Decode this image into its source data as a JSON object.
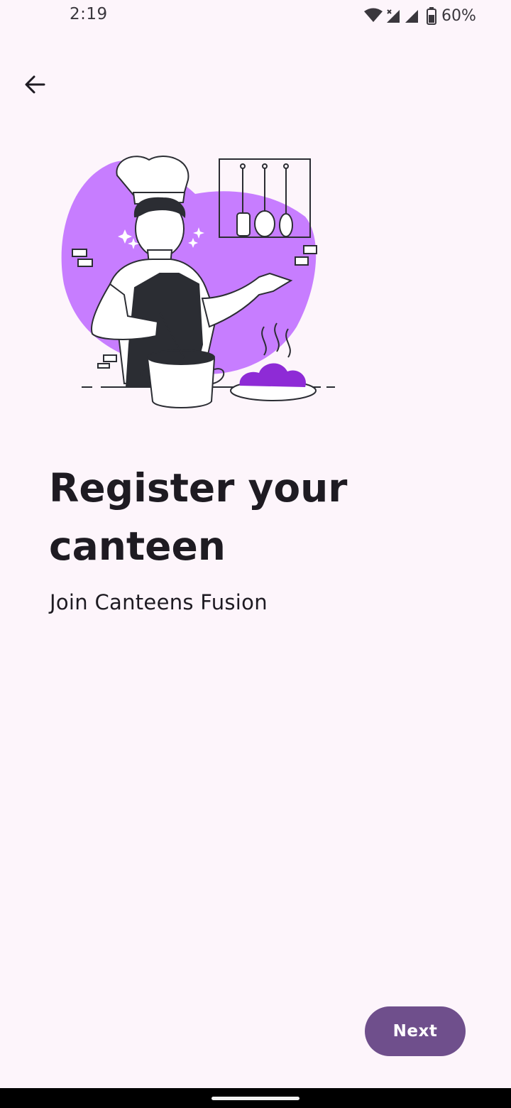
{
  "status_bar": {
    "time": "2:19",
    "battery": "60%",
    "icons": [
      "wifi-icon",
      "signal-icon",
      "signal-icon",
      "battery-icon"
    ]
  },
  "header": {
    "back_icon": "arrow-left-icon"
  },
  "illustration": {
    "subject": "chef-cooking-illustration",
    "accent_color": "#c77dff",
    "dark_accent_color": "#8e2bd6"
  },
  "main": {
    "title": "Register your canteen",
    "subtitle": "Join Canteens Fusion"
  },
  "footer": {
    "next_label": "Next",
    "next_color": "#6f4f8c"
  },
  "colors": {
    "background": "#fdf5fb",
    "text": "#1e1b22"
  }
}
